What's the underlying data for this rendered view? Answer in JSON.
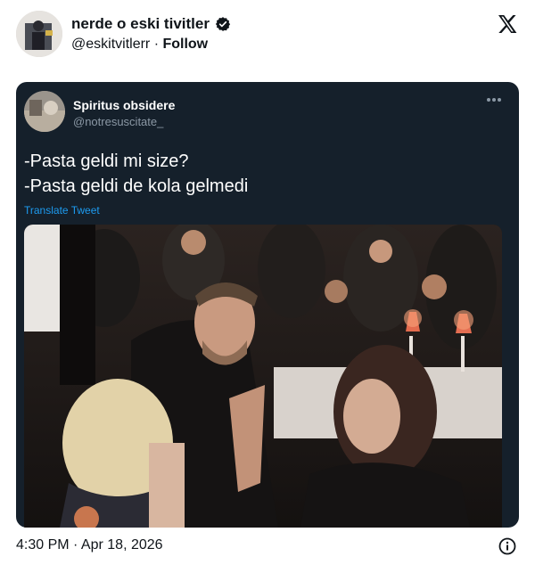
{
  "author": {
    "name": "nerde o eski tivitler",
    "handle": "@eskitvitlerr",
    "separator": " · ",
    "follow_label": "Follow"
  },
  "quoted": {
    "name": "Spiritus obsidere",
    "handle": "@notresuscitate_",
    "lines": [
      "-Pasta geldi mi size?",
      "-Pasta geldi de kola gelmedi"
    ],
    "translate_label": "Translate Tweet"
  },
  "footer": {
    "timestamp": "4:30 PM · Apr 18, 2026"
  },
  "icons": {
    "verified": "verified-badge-icon",
    "brand": "x-logo-icon",
    "more": "more-options-icon",
    "info": "info-icon"
  },
  "colors": {
    "quote_bg": "#15202b",
    "link": "#1d9bf0",
    "muted": "#8b98a5"
  }
}
